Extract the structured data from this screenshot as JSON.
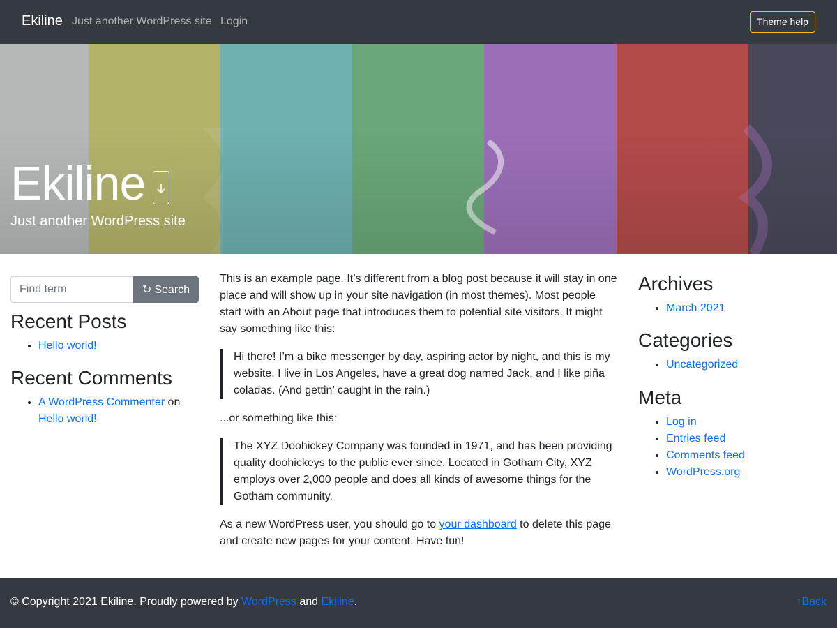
{
  "navbar": {
    "brand": "Ekiline",
    "tagline": "Just another WordPress site",
    "login": "Login",
    "theme_help": "Theme help"
  },
  "hero": {
    "title": "Ekiline",
    "tagline": "Just another WordPress site",
    "bar_colors": [
      "#b4b8b6",
      "#b3b46a",
      "#6fb0b0",
      "#6aa878",
      "#9b6fb8",
      "#b34a4a",
      "#48485a"
    ]
  },
  "search": {
    "placeholder": "Find term",
    "button": "Search"
  },
  "sidebar_left": {
    "recent_posts_title": "Recent Posts",
    "recent_posts": [
      "Hello world!"
    ],
    "recent_comments_title": "Recent Comments",
    "comment_author": "A WordPress Commenter",
    "comment_on": "on",
    "comment_post": "Hello world!"
  },
  "content": {
    "p1": "This is an example page. It’s different from a blog post because it will stay in one place and will show up in your site navigation (in most themes). Most people start with an About page that introduces them to potential site visitors. It might say something like this:",
    "quote1": "Hi there! I’m a bike messenger by day, aspiring actor by night, and this is my website. I live in Los Angeles, have a great dog named Jack, and I like piña coladas. (And gettin’ caught in the rain.)",
    "p2": "...or something like this:",
    "quote2": "The XYZ Doohickey Company was founded in 1971, and has been providing quality doohickeys to the public ever since. Located in Gotham City, XYZ employs over 2,000 people and does all kinds of awesome things for the Gotham community.",
    "p3_before": "As a new WordPress user, you should go to ",
    "p3_link": "your dashboard",
    "p3_after": " to delete this page and create new pages for your content. Have fun!"
  },
  "sidebar_right": {
    "archives_title": "Archives",
    "archives": [
      "March 2021"
    ],
    "categories_title": "Categories",
    "categories": [
      "Uncategorized"
    ],
    "meta_title": "Meta",
    "meta": [
      "Log in",
      "Entries feed",
      "Comments feed",
      "WordPress.org"
    ]
  },
  "footer": {
    "copy_before": "© Copyright 2021 Ekiline. Proudly powered by ",
    "link1": "WordPress",
    "and": " and ",
    "link2": "Ekiline",
    "period": ".",
    "back": "Back"
  }
}
